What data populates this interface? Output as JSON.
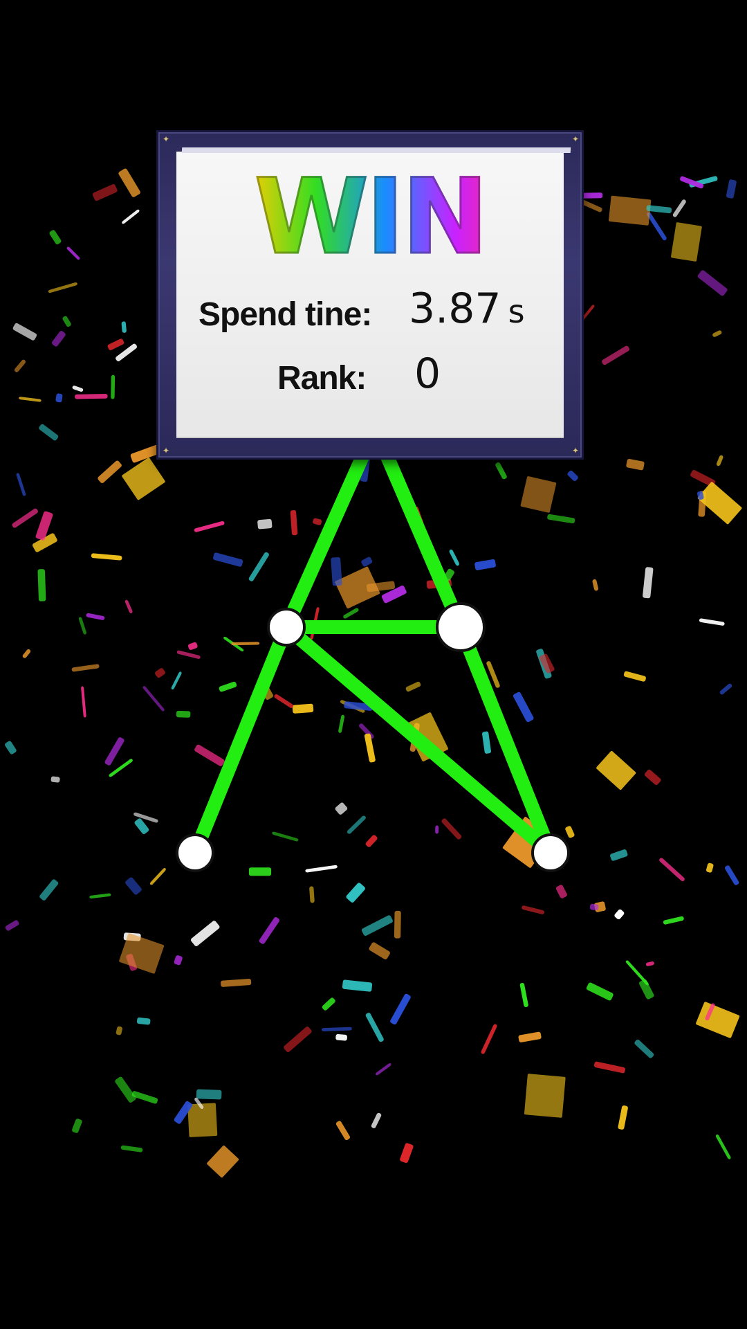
{
  "win_panel": {
    "title": "WIN",
    "spend_time_label": "Spend tine:",
    "spend_time_value": "3.87",
    "spend_time_unit": "s",
    "rank_label": "Rank:",
    "rank_value": "0"
  },
  "puzzle": {
    "line_color": "#22ee11",
    "node_fill": "#ffffff",
    "node_stroke": "#111111",
    "nodes": [
      {
        "id": "top-left-anchor"
      },
      {
        "id": "top-right-anchor"
      },
      {
        "id": "middle-left"
      },
      {
        "id": "middle-right"
      },
      {
        "id": "bottom-left"
      },
      {
        "id": "bottom-right"
      }
    ]
  },
  "colors": {
    "background": "#000000",
    "panel_frame": "#2c2a5a",
    "panel_paper": "#f2f2f2",
    "confetti": [
      "#e0262b",
      "#f4c21c",
      "#2fe21d",
      "#2a4fd6",
      "#b02be0",
      "#ff2f8f",
      "#e8962a",
      "#ffffff",
      "#32c8c8"
    ]
  }
}
